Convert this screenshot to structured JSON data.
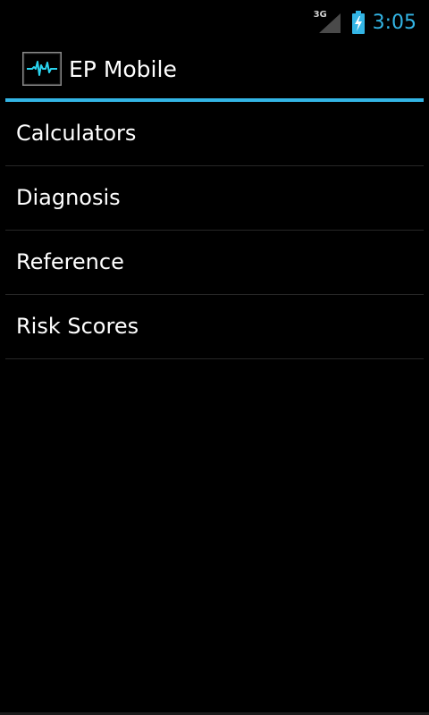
{
  "status_bar": {
    "network_type": "3G",
    "time": "3:05",
    "icons": [
      "signal-icon",
      "battery-charging-icon"
    ]
  },
  "action_bar": {
    "title": "EP Mobile",
    "icon": "ecg-icon"
  },
  "menu": {
    "items": [
      {
        "label": "Calculators"
      },
      {
        "label": "Diagnosis"
      },
      {
        "label": "Reference"
      },
      {
        "label": "Risk Scores"
      }
    ]
  },
  "colors": {
    "accent": "#33b5e5",
    "background": "#000000",
    "text": "#ffffff",
    "divider": "#262626"
  }
}
